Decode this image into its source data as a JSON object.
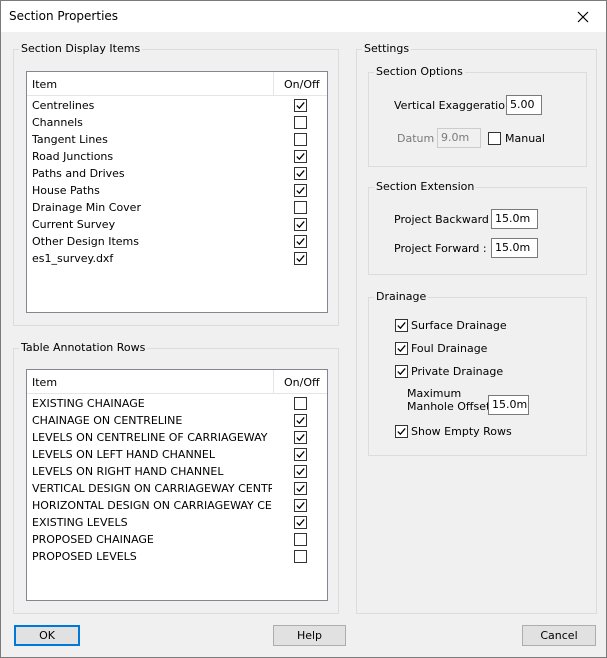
{
  "window": {
    "title": "Section Properties"
  },
  "display_items": {
    "legend": "Section Display Items",
    "header_item": "Item",
    "header_onoff": "On/Off",
    "rows": [
      {
        "label": "Centrelines",
        "checked": true
      },
      {
        "label": "Channels",
        "checked": false
      },
      {
        "label": "Tangent Lines",
        "checked": false
      },
      {
        "label": "Road Junctions",
        "checked": true
      },
      {
        "label": "Paths and Drives",
        "checked": true
      },
      {
        "label": "House Paths",
        "checked": true
      },
      {
        "label": "Drainage Min Cover",
        "checked": false
      },
      {
        "label": "Current Survey",
        "checked": true
      },
      {
        "label": "Other Design Items",
        "checked": true
      },
      {
        "label": "es1_survey.dxf",
        "checked": true
      }
    ]
  },
  "annotation_rows": {
    "legend": "Table Annotation Rows",
    "header_item": "Item",
    "header_onoff": "On/Off",
    "rows": [
      {
        "label": "EXISTING CHAINAGE",
        "checked": false
      },
      {
        "label": "CHAINAGE ON CENTRELINE",
        "checked": true
      },
      {
        "label": "LEVELS ON CENTRELINE OF CARRIAGEWAY",
        "checked": true
      },
      {
        "label": "LEVELS ON LEFT HAND CHANNEL",
        "checked": true
      },
      {
        "label": "LEVELS ON RIGHT HAND CHANNEL",
        "checked": true
      },
      {
        "label": "VERTICAL DESIGN ON CARRIAGEWAY CENTRI",
        "checked": true
      },
      {
        "label": "HORIZONTAL DESIGN ON CARRIAGEWAY CEN",
        "checked": true
      },
      {
        "label": "EXISTING LEVELS",
        "checked": true
      },
      {
        "label": "PROPOSED CHAINAGE",
        "checked": false
      },
      {
        "label": "PROPOSED LEVELS",
        "checked": false
      }
    ]
  },
  "settings": {
    "legend": "Settings",
    "section_options": {
      "legend": "Section Options",
      "vertical_exaggeration_label": "Vertical Exaggeration :",
      "vertical_exaggeration_value": "5.00",
      "datum_label": "Datum :",
      "datum_value": "9.0m",
      "manual_label": "Manual",
      "manual_checked": false
    },
    "section_extension": {
      "legend": "Section Extension",
      "project_backward_label": "Project Backward :",
      "project_backward_value": "15.0m",
      "project_forward_label": "Project Forward :",
      "project_forward_value": "15.0m"
    },
    "drainage": {
      "legend": "Drainage",
      "surface_drainage_label": "Surface Drainage",
      "surface_drainage_checked": true,
      "foul_drainage_label": "Foul Drainage",
      "foul_drainage_checked": true,
      "private_drainage_label": "Private Drainage",
      "private_drainage_checked": true,
      "max_offset_label_line1": "Maximum",
      "max_offset_label_line2": "Manhole Offset :",
      "max_offset_value": "15.0m",
      "show_empty_rows_label": "Show Empty Rows",
      "show_empty_rows_checked": true
    }
  },
  "buttons": {
    "ok": "OK",
    "help": "Help",
    "cancel": "Cancel"
  },
  "colors": {
    "focus_border": "#0078d7",
    "dialog_bg": "#f0f0f0"
  }
}
